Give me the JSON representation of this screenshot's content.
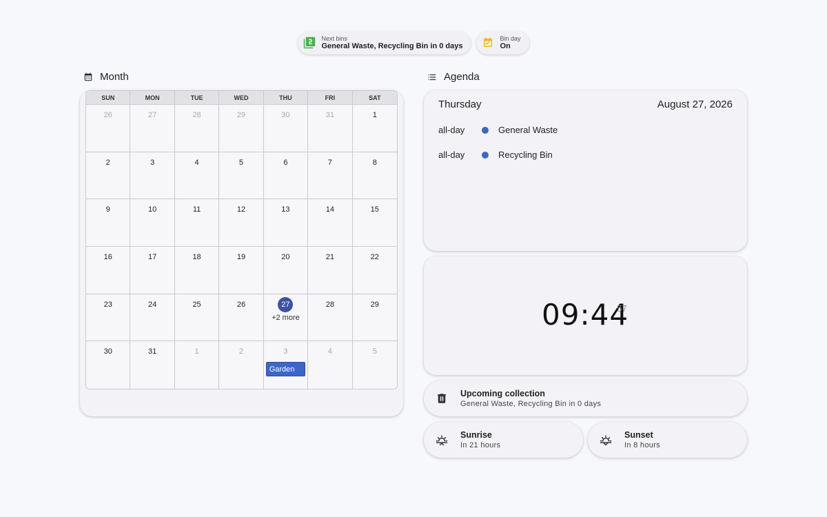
{
  "chips": [
    {
      "icon": "numbered-bin-icon",
      "label": "Next bins",
      "value": "General Waste, Recycling Bin in 0 days",
      "color": "#4caf50"
    },
    {
      "icon": "calendar-check-icon",
      "label": "Bin day",
      "value": "On",
      "color": "#f4b400"
    }
  ],
  "calendar": {
    "heading": "Month",
    "weekdays": [
      "SUN",
      "MON",
      "TUE",
      "WED",
      "THU",
      "FRI",
      "SAT"
    ],
    "weeks": [
      [
        "26",
        "27",
        "28",
        "29",
        "30",
        "31",
        "1"
      ],
      [
        "2",
        "3",
        "4",
        "5",
        "6",
        "7",
        "8"
      ],
      [
        "9",
        "10",
        "11",
        "12",
        "13",
        "14",
        "15"
      ],
      [
        "16",
        "17",
        "18",
        "19",
        "20",
        "21",
        "22"
      ],
      [
        "23",
        "24",
        "25",
        "26",
        "27",
        "28",
        "29"
      ],
      [
        "30",
        "31",
        "1",
        "2",
        "3",
        "4",
        "5"
      ]
    ],
    "today": "27",
    "today_more": "+2 more",
    "event": {
      "title": "Garden",
      "color": "#3c66c8"
    },
    "today_color": "#3f51a5"
  },
  "agenda": {
    "heading": "Agenda",
    "day_name": "Thursday",
    "date": "August 27, 2026",
    "events": [
      {
        "when": "all-day",
        "title": "General Waste",
        "color": "#3c66c8"
      },
      {
        "when": "all-day",
        "title": "Recycling Bin",
        "color": "#3c66c8"
      }
    ]
  },
  "clock": {
    "time": "09:44",
    "seconds": "57"
  },
  "upcoming": {
    "icon": "trash-icon",
    "title": "Upcoming collection",
    "subtitle": "General Waste, Recycling Bin in 0 days"
  },
  "sunrise": {
    "icon": "sunrise-icon",
    "title": "Sunrise",
    "subtitle": "In 21 hours"
  },
  "sunset": {
    "icon": "sunset-icon",
    "title": "Sunset",
    "subtitle": "In 8 hours"
  }
}
